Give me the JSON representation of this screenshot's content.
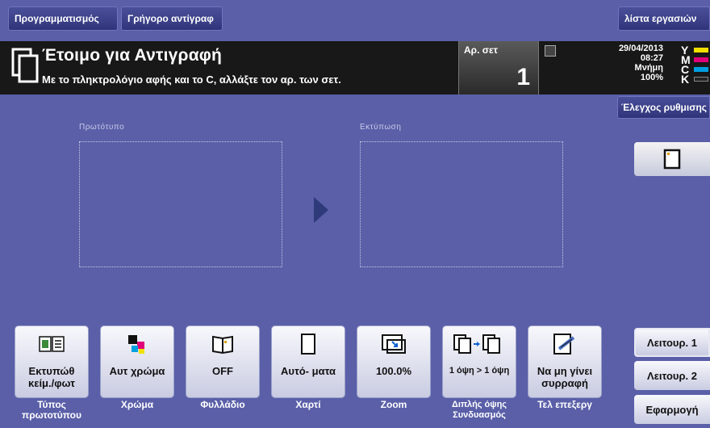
{
  "top_tabs": {
    "programs": "Προγραμματισμός",
    "quick_copy": "Γρήγορο αντίγραφ",
    "job_list": "λίστα εργασιών"
  },
  "status": {
    "title": "Έτοιμο για Αντιγραφή",
    "subtitle": "Με το πληκτρολόγιο αφής και το C, αλλάξτε τον αρ. των σετ.",
    "sets_label": "Αρ. σετ",
    "sets_value": "1",
    "date": "29/04/2013",
    "time": "08:27",
    "memory_label": "Μνήμη",
    "memory_value": "100%",
    "toner": [
      {
        "letter": "Y",
        "color": "#f0e000"
      },
      {
        "letter": "M",
        "color": "#e0007a"
      },
      {
        "letter": "C",
        "color": "#00a0e0"
      },
      {
        "letter": "K",
        "color": "#222222"
      }
    ]
  },
  "check_settings": "Έλεγχος ρυθμισης",
  "preview": {
    "original_label": "Πρωτότυπο",
    "output_label": "Εκτύπωση"
  },
  "functions": [
    {
      "value": "Εκτυπώθ κείμ./φωτ",
      "caption": "Τύπος πρωτοτύπου",
      "icon": "text-photo-icon"
    },
    {
      "value": "Αυτ χρώμα",
      "caption": "Χρώμα",
      "icon": "auto-color-icon"
    },
    {
      "value": "OFF",
      "caption": "Φυλλάδιο",
      "icon": "booklet-icon"
    },
    {
      "value": "Αυτό- ματα",
      "caption": "Χαρτί",
      "icon": "paper-icon"
    },
    {
      "value": "100.0%",
      "caption": "Zoom",
      "icon": "zoom-icon"
    },
    {
      "value": "1 όψη > 1 όψη",
      "caption": "Διπλής όψης Συνδυασμός",
      "icon": "duplex-icon"
    },
    {
      "value": "Να μη γίνει συρραφή",
      "caption": "Τελ επεξεργ",
      "icon": "finishing-icon"
    }
  ],
  "side_buttons": {
    "func1": "Λειτουρ. 1",
    "func2": "Λειτουρ. 2",
    "apply": "Εφαρμογή"
  }
}
